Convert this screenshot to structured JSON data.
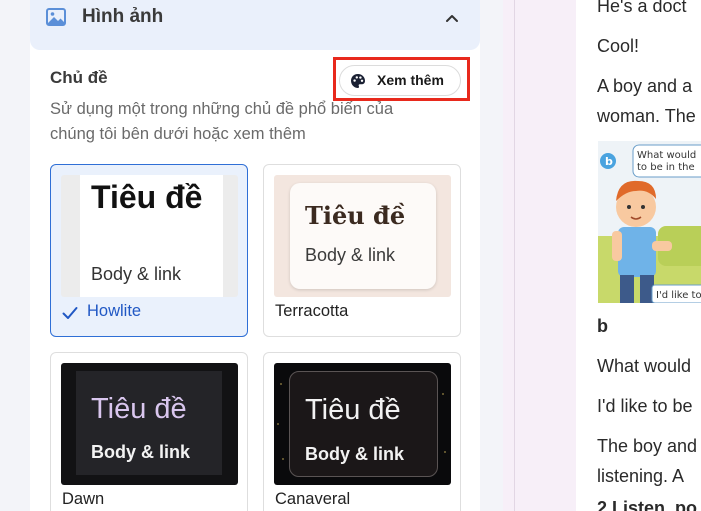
{
  "section": {
    "title": "Hình ảnh",
    "icon": "image-icon",
    "collapse_icon": "chevron-up-icon"
  },
  "theme": {
    "label": "Chủ đề",
    "description": "Sử dụng một trong những chủ đề phổ biến của chúng tôi bên dưới hoặc xem thêm",
    "more_button": {
      "label": "Xem thêm",
      "icon": "palette-icon"
    }
  },
  "themes": [
    {
      "name": "Howlite",
      "preview_title": "Tiêu đề",
      "preview_body": "Body & link",
      "selected": true
    },
    {
      "name": "Terracotta",
      "preview_title": "Tiêu đề",
      "preview_body": "Body & link",
      "selected": false
    },
    {
      "name": "Dawn",
      "preview_title": "Tiêu đề",
      "preview_body": "Body & link",
      "selected": false
    },
    {
      "name": "Canaveral",
      "preview_title": "Tiêu đề",
      "preview_body": "Body & link",
      "selected": false
    }
  ],
  "document": {
    "lines": [
      "He's a doct",
      "Cool!",
      "A boy and a",
      "woman. The",
      "b",
      "What would",
      "I'd like to be",
      "The boy and",
      "listening. A",
      "2 Listen, po"
    ],
    "bubble_line1": "What would",
    "bubble_line2": "to be in the",
    "bubble_reply": "I'd like to",
    "picture_label": "b"
  },
  "colors": {
    "accent": "#2f6fd6",
    "highlight": "#e8291c",
    "panel_bg": "#f3f4f9",
    "doc_bg": "#f7eff8"
  }
}
